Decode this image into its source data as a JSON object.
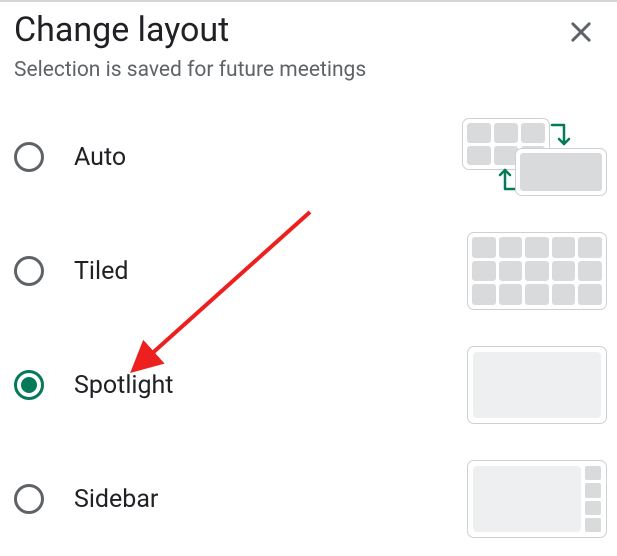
{
  "dialog": {
    "title": "Change layout",
    "subtitle": "Selection is saved for future meetings"
  },
  "options": [
    {
      "id": "auto",
      "label": "Auto",
      "selected": false
    },
    {
      "id": "tiled",
      "label": "Tiled",
      "selected": false
    },
    {
      "id": "spotlight",
      "label": "Spotlight",
      "selected": true
    },
    {
      "id": "sidebar",
      "label": "Sidebar",
      "selected": false
    }
  ],
  "colors": {
    "accent": "#047a5b",
    "text_primary": "#202124",
    "text_secondary": "#5f6368",
    "thumb_fill": "#d9dadb",
    "thumb_fill_light": "#eeeff0",
    "annotation": "#ee1f1f"
  }
}
